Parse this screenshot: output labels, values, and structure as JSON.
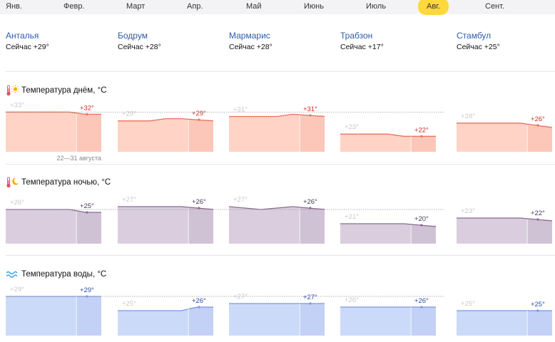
{
  "months": [
    "Янв.",
    "Февр.",
    "Март",
    "Апр.",
    "Май",
    "Июнь",
    "Июль",
    "Авг.",
    "Сент."
  ],
  "active_month_index": 7,
  "cities": [
    {
      "name": "Анталья",
      "now": "Сейчас +29°"
    },
    {
      "name": "Бодрум",
      "now": "Сейчас +28°"
    },
    {
      "name": "Мармарис",
      "now": "Сейчас +28°"
    },
    {
      "name": "Трабзон",
      "now": "Сейчас +17°"
    },
    {
      "name": "Стамбул",
      "now": "Сейчас +25°"
    }
  ],
  "sections": {
    "day": {
      "title": "Температура днём, °C",
      "icon": "thermometer-sun-icon"
    },
    "night": {
      "title": "Температура ночью, °C",
      "icon": "thermometer-moon-icon"
    },
    "water": {
      "title": "Температура воды, °C",
      "icon": "waves-icon"
    }
  },
  "period_note": "22—31 августа",
  "colors": {
    "day": "#e9725e",
    "day_fill": "#ffd1c3",
    "night": "#8a6a92",
    "night_fill": "#d8cbdc",
    "water": "#7d97df",
    "water_fill": "#c9d8f9",
    "active_month": "#ffd83b"
  },
  "chart_data": [
    {
      "type": "area",
      "metric": "day",
      "city": "Анталья",
      "ylim": [
        15,
        36
      ],
      "series": [
        {
          "values": [
            33,
            33,
            33,
            33,
            33,
            32,
            32
          ]
        }
      ],
      "start_label": "+33°",
      "end_label": "+32°"
    },
    {
      "type": "area",
      "metric": "day",
      "city": "Бодрум",
      "ylim": [
        15,
        36
      ],
      "series": [
        {
          "values": [
            29,
            29,
            29,
            30,
            30,
            29.5,
            29
          ]
        }
      ],
      "start_label": "+29°",
      "end_label": "+29°"
    },
    {
      "type": "area",
      "metric": "day",
      "city": "Мармарис",
      "ylim": [
        15,
        36
      ],
      "series": [
        {
          "values": [
            31,
            31,
            31,
            31,
            32,
            31.5,
            31
          ]
        }
      ],
      "start_label": "+31°",
      "end_label": "+31°"
    },
    {
      "type": "area",
      "metric": "day",
      "city": "Трабзон",
      "ylim": [
        15,
        36
      ],
      "series": [
        {
          "values": [
            23,
            23,
            23,
            23,
            22,
            22,
            22
          ]
        }
      ],
      "start_label": "+23°",
      "end_label": "+22°"
    },
    {
      "type": "area",
      "metric": "day",
      "city": "Стамбул",
      "ylim": [
        15,
        36
      ],
      "series": [
        {
          "values": [
            28,
            28,
            28,
            28,
            28,
            27,
            26
          ]
        }
      ],
      "start_label": "+28°",
      "end_label": "+26°"
    },
    {
      "type": "area",
      "metric": "night",
      "city": "Анталья",
      "ylim": [
        14,
        30
      ],
      "series": [
        {
          "values": [
            26,
            26,
            26,
            26,
            26,
            25,
            25
          ]
        }
      ],
      "start_label": "+26°",
      "end_label": "+25°"
    },
    {
      "type": "area",
      "metric": "night",
      "city": "Бодрум",
      "ylim": [
        14,
        30
      ],
      "series": [
        {
          "values": [
            27,
            27,
            27,
            27,
            27,
            26.5,
            26
          ]
        }
      ],
      "start_label": "+27°",
      "end_label": "+26°"
    },
    {
      "type": "area",
      "metric": "night",
      "city": "Мармарис",
      "ylim": [
        14,
        30
      ],
      "series": [
        {
          "values": [
            27,
            26.5,
            26,
            26.5,
            27,
            26.5,
            26
          ]
        }
      ],
      "start_label": "+27°",
      "end_label": "+26°"
    },
    {
      "type": "area",
      "metric": "night",
      "city": "Трабзон",
      "ylim": [
        14,
        30
      ],
      "series": [
        {
          "values": [
            21,
            21,
            21,
            21,
            21,
            20.5,
            20
          ]
        }
      ],
      "start_label": "+21°",
      "end_label": "+20°"
    },
    {
      "type": "area",
      "metric": "night",
      "city": "Стамбул",
      "ylim": [
        14,
        30
      ],
      "series": [
        {
          "values": [
            23,
            23,
            23,
            23,
            23,
            22.5,
            22
          ]
        }
      ],
      "start_label": "+23°",
      "end_label": "+22°"
    },
    {
      "type": "area",
      "metric": "water",
      "city": "Анталья",
      "ylim": [
        18,
        31
      ],
      "series": [
        {
          "values": [
            29,
            29,
            29,
            29,
            29,
            29,
            29
          ]
        }
      ],
      "start_label": "+29°",
      "end_label": "+29°"
    },
    {
      "type": "area",
      "metric": "water",
      "city": "Бодрум",
      "ylim": [
        18,
        31
      ],
      "series": [
        {
          "values": [
            25,
            25,
            25,
            25,
            25,
            26,
            26
          ]
        }
      ],
      "start_label": "+25°",
      "end_label": "+26°"
    },
    {
      "type": "area",
      "metric": "water",
      "city": "Мармарис",
      "ylim": [
        18,
        31
      ],
      "series": [
        {
          "values": [
            27,
            27,
            27,
            27,
            27,
            27,
            27
          ]
        }
      ],
      "start_label": "+27°",
      "end_label": "+27°"
    },
    {
      "type": "area",
      "metric": "water",
      "city": "Трабзон",
      "ylim": [
        18,
        31
      ],
      "series": [
        {
          "values": [
            26,
            26,
            26,
            26,
            26,
            26,
            26
          ]
        }
      ],
      "start_label": "+26°",
      "end_label": "+26°"
    },
    {
      "type": "area",
      "metric": "water",
      "city": "Стамбул",
      "ylim": [
        18,
        31
      ],
      "series": [
        {
          "values": [
            25,
            25,
            25,
            25,
            25,
            25,
            25
          ]
        }
      ],
      "start_label": "+25°",
      "end_label": "+25°"
    }
  ]
}
